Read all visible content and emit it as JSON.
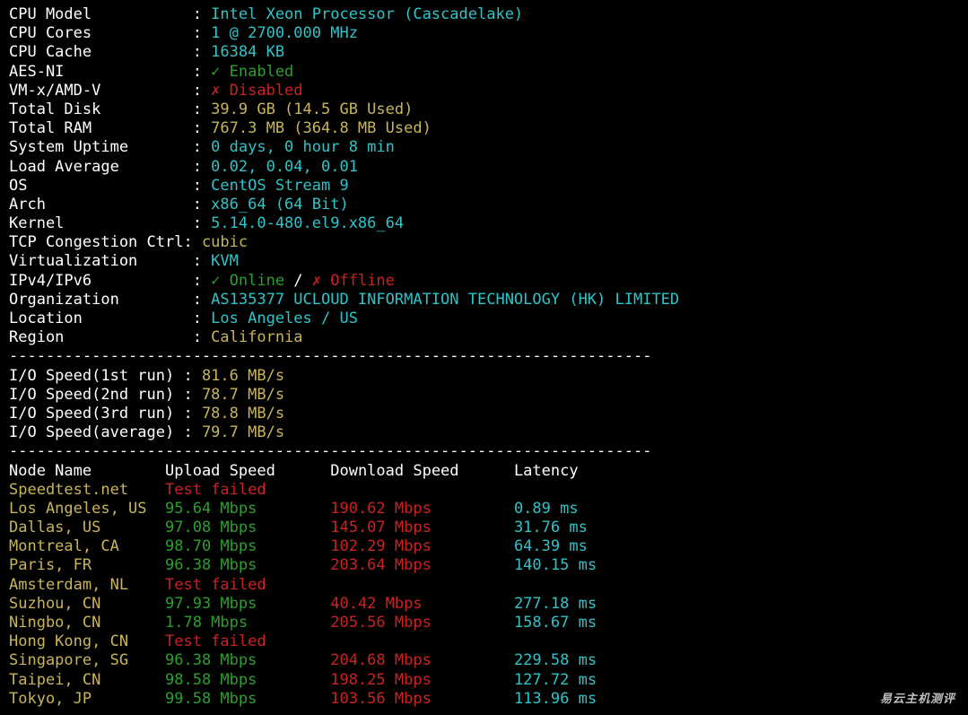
{
  "system_info": [
    {
      "label": "CPU Model           ",
      "value": "Intel Xeon Processor (Cascadelake)",
      "color": "cyan"
    },
    {
      "label": "CPU Cores           ",
      "value": "1 @ 2700.000 MHz",
      "color": "cyan"
    },
    {
      "label": "CPU Cache           ",
      "value": "16384 KB",
      "color": "cyan"
    },
    {
      "label": "AES-NI              ",
      "value": "✓ Enabled",
      "color": "green"
    },
    {
      "label": "VM-x/AMD-V          ",
      "value": "✗ Disabled",
      "color": "red"
    },
    {
      "label": "Total Disk          ",
      "value": "39.9 GB (14.5 GB Used)",
      "color": "yellow"
    },
    {
      "label": "Total RAM           ",
      "value": "767.3 MB (364.8 MB Used)",
      "color": "yellow"
    },
    {
      "label": "System Uptime       ",
      "value": "0 days, 0 hour 8 min",
      "color": "cyan"
    },
    {
      "label": "Load Average        ",
      "value": "0.02, 0.04, 0.01",
      "color": "cyan"
    },
    {
      "label": "OS                  ",
      "value": "CentOS Stream 9",
      "color": "cyan"
    },
    {
      "label": "Arch                ",
      "value": "x86_64 (64 Bit)",
      "color": "cyan"
    },
    {
      "label": "Kernel              ",
      "value": "5.14.0-480.el9.x86_64",
      "color": "cyan"
    },
    {
      "label": "TCP Congestion Ctrl",
      "value": "cubic",
      "color": "yellow"
    },
    {
      "label": "Virtualization      ",
      "value": "KVM",
      "color": "cyan"
    }
  ],
  "ip_line": {
    "label": "IPv4/IPv6           ",
    "online": "✓ Online",
    "slash": " / ",
    "offline": "✗ Offline"
  },
  "location_info": [
    {
      "label": "Organization        ",
      "value": "AS135377 UCLOUD INFORMATION TECHNOLOGY (HK) LIMITED",
      "color": "cyan"
    },
    {
      "label": "Location            ",
      "value": "Los Angeles / US",
      "color": "cyan"
    },
    {
      "label": "Region              ",
      "value": "California",
      "color": "yellow"
    }
  ],
  "separator": "----------------------------------------------------------------------",
  "io_speed": [
    {
      "label": "I/O Speed(1st run) ",
      "value": "81.6 MB/s"
    },
    {
      "label": "I/O Speed(2nd run) ",
      "value": "78.7 MB/s"
    },
    {
      "label": "I/O Speed(3rd run) ",
      "value": "78.8 MB/s"
    },
    {
      "label": "I/O Speed(average) ",
      "value": "79.7 MB/s"
    }
  ],
  "speed_table": {
    "headers": [
      "Node Name",
      "Upload Speed",
      "Download Speed",
      "Latency"
    ],
    "rows": [
      {
        "node": "Speedtest.net",
        "failed": "Test failed"
      },
      {
        "node": "Los Angeles, US",
        "upload": "95.64 Mbps",
        "download": "190.62 Mbps",
        "latency": "0.89 ms"
      },
      {
        "node": "Dallas, US",
        "upload": "97.08 Mbps",
        "download": "145.07 Mbps",
        "latency": "31.76 ms"
      },
      {
        "node": "Montreal, CA",
        "upload": "98.70 Mbps",
        "download": "102.29 Mbps",
        "latency": "64.39 ms"
      },
      {
        "node": "Paris, FR",
        "upload": "96.38 Mbps",
        "download": "203.64 Mbps",
        "latency": "140.15 ms"
      },
      {
        "node": "Amsterdam, NL",
        "failed": "Test failed"
      },
      {
        "node": "Suzhou, CN",
        "upload": "97.93 Mbps",
        "download": "40.42 Mbps",
        "latency": "277.18 ms"
      },
      {
        "node": "Ningbo, CN",
        "upload": "1.78 Mbps",
        "download": "205.56 Mbps",
        "latency": "158.67 ms"
      },
      {
        "node": "Hong Kong, CN",
        "failed": "Test failed"
      },
      {
        "node": "Singapore, SG",
        "upload": "96.38 Mbps",
        "download": "204.68 Mbps",
        "latency": "229.58 ms"
      },
      {
        "node": "Taipei, CN",
        "upload": "98.58 Mbps",
        "download": "198.25 Mbps",
        "latency": "127.72 ms"
      },
      {
        "node": "Tokyo, JP",
        "upload": "99.58 Mbps",
        "download": "103.56 Mbps",
        "latency": "113.96 ms"
      }
    ]
  },
  "watermark": "易云主机测评",
  "colors": {
    "background": "#000000",
    "cyan": "#2ec4c9",
    "yellow": "#c9b458",
    "green": "#2e9e2e",
    "red": "#cc2222"
  }
}
